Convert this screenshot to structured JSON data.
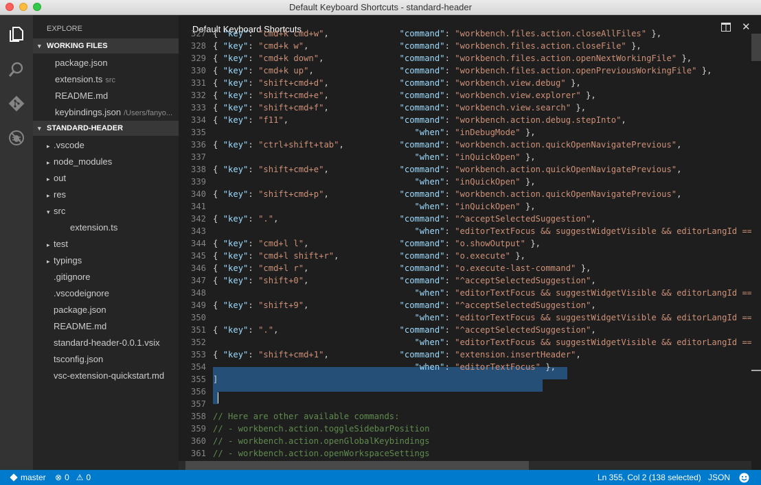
{
  "window": {
    "title": "Default Keyboard Shortcuts - standard-header"
  },
  "activity": [
    "files-icon",
    "search-icon",
    "git-icon",
    "debug-icon"
  ],
  "sidebar": {
    "title": "EXPLORE",
    "working_files": {
      "header": "WORKING FILES",
      "items": [
        {
          "name": "package.json",
          "desc": ""
        },
        {
          "name": "extension.ts",
          "desc": "src"
        },
        {
          "name": "README.md",
          "desc": ""
        },
        {
          "name": "keybindings.json",
          "desc": "/Users/fanyo..."
        }
      ]
    },
    "project": {
      "header": "STANDARD-HEADER",
      "items": [
        {
          "name": ".vscode",
          "twisty": "▸",
          "indent": 1
        },
        {
          "name": "node_modules",
          "twisty": "▸",
          "indent": 1
        },
        {
          "name": "out",
          "twisty": "▸",
          "indent": 1
        },
        {
          "name": "res",
          "twisty": "▸",
          "indent": 1
        },
        {
          "name": "src",
          "twisty": "▾",
          "indent": 1
        },
        {
          "name": "extension.ts",
          "twisty": "",
          "indent": 2
        },
        {
          "name": "test",
          "twisty": "▸",
          "indent": 1
        },
        {
          "name": "typings",
          "twisty": "▸",
          "indent": 1
        },
        {
          "name": ".gitignore",
          "twisty": "",
          "indent": 1
        },
        {
          "name": ".vscodeignore",
          "twisty": "",
          "indent": 1
        },
        {
          "name": "package.json",
          "twisty": "",
          "indent": 1
        },
        {
          "name": "README.md",
          "twisty": "",
          "indent": 1
        },
        {
          "name": "standard-header-0.0.1.vsix",
          "twisty": "",
          "indent": 1
        },
        {
          "name": "tsconfig.json",
          "twisty": "",
          "indent": 1
        },
        {
          "name": "vsc-extension-quickstart.md",
          "twisty": "",
          "indent": 1
        }
      ]
    }
  },
  "editor": {
    "title": "Default Keyboard Shortcuts",
    "lines": [
      {
        "n": "327",
        "key": "cmd+k cmd+w",
        "cmd": "workbench.files.action.closeAllFiles",
        "end": " },",
        "when": null
      },
      {
        "n": "328",
        "key": "cmd+k w",
        "cmd": "workbench.files.action.closeFile",
        "end": " },",
        "when": null
      },
      {
        "n": "329",
        "key": "cmd+k down",
        "cmd": "workbench.files.action.openNextWorkingFile",
        "end": " },",
        "when": null
      },
      {
        "n": "330",
        "key": "cmd+k up",
        "cmd": "workbench.files.action.openPreviousWorkingFile",
        "end": " },",
        "when": null
      },
      {
        "n": "331",
        "key": "shift+cmd+d",
        "cmd": "workbench.view.debug",
        "end": " },",
        "when": null
      },
      {
        "n": "332",
        "key": "shift+cmd+e",
        "cmd": "workbench.view.explorer",
        "end": " },",
        "when": null
      },
      {
        "n": "333",
        "key": "shift+cmd+f",
        "cmd": "workbench.view.search",
        "end": " },",
        "when": null
      },
      {
        "n": "334",
        "key": "f11",
        "cmd": "workbench.action.debug.stepInto",
        "end": ",",
        "when": null
      },
      {
        "n": "335",
        "key": null,
        "cmd": null,
        "end": " },",
        "when": "inDebugMode"
      },
      {
        "n": "336",
        "key": "ctrl+shift+tab",
        "cmd": "workbench.action.quickOpenNavigatePrevious",
        "end": ",",
        "when": null
      },
      {
        "n": "337",
        "key": null,
        "cmd": null,
        "end": " },",
        "when": "inQuickOpen"
      },
      {
        "n": "338",
        "key": "shift+cmd+e",
        "cmd": "workbench.action.quickOpenNavigatePrevious",
        "end": ",",
        "when": null
      },
      {
        "n": "339",
        "key": null,
        "cmd": null,
        "end": " },",
        "when": "inQuickOpen"
      },
      {
        "n": "340",
        "key": "shift+cmd+p",
        "cmd": "workbench.action.quickOpenNavigatePrevious",
        "end": ",",
        "when": null
      },
      {
        "n": "341",
        "key": null,
        "cmd": null,
        "end": " },",
        "when": "inQuickOpen"
      },
      {
        "n": "342",
        "key": ".",
        "cmd": "^acceptSelectedSuggestion",
        "end": ",",
        "when": null
      },
      {
        "n": "343",
        "key": null,
        "cmd": null,
        "end": "",
        "when": "editorTextFocus && suggestWidgetVisible && editorLangId == 'types"
      },
      {
        "n": "344",
        "key": "cmd+l l",
        "cmd": "o.showOutput",
        "end": " },",
        "when": null
      },
      {
        "n": "345",
        "key": "cmd+l shift+r",
        "cmd": "o.execute",
        "end": " },",
        "when": null
      },
      {
        "n": "346",
        "key": "cmd+l r",
        "cmd": "o.execute-last-command",
        "end": " },",
        "when": null
      },
      {
        "n": "347",
        "key": "shift+0",
        "cmd": "^acceptSelectedSuggestion",
        "end": ",",
        "when": null
      },
      {
        "n": "348",
        "key": null,
        "cmd": null,
        "end": "",
        "when": "editorTextFocus && suggestWidgetVisible && editorLangId == 'cshar"
      },
      {
        "n": "349",
        "key": "shift+9",
        "cmd": "^acceptSelectedSuggestion",
        "end": ",",
        "when": null
      },
      {
        "n": "350",
        "key": null,
        "cmd": null,
        "end": "",
        "when": "editorTextFocus && suggestWidgetVisible && editorLangId == 'cshar"
      },
      {
        "n": "351",
        "key": ".",
        "cmd": "^acceptSelectedSuggestion",
        "end": ",",
        "when": null
      },
      {
        "n": "352",
        "key": null,
        "cmd": null,
        "end": "",
        "when": "editorTextFocus && suggestWidgetVisible && editorLangId == 'cshar"
      },
      {
        "n": "353",
        "key": "shift+cmd+1",
        "cmd": "extension.insertHeader",
        "end": ",",
        "when": null
      },
      {
        "n": "354",
        "key": null,
        "cmd": null,
        "end": " },",
        "when": "editorTextFocus"
      },
      {
        "n": "355",
        "raw": "]"
      },
      {
        "n": "356",
        "raw": ""
      },
      {
        "n": "357",
        "raw": ""
      },
      {
        "n": "358",
        "comment": "// Here are other available commands:"
      },
      {
        "n": "359",
        "comment": "// - workbench.action.toggleSidebarPosition"
      },
      {
        "n": "360",
        "comment": "// - workbench.action.openGlobalKeybindings"
      },
      {
        "n": "361",
        "comment": "// - workbench.action.openWorkspaceSettings"
      }
    ]
  },
  "status": {
    "branch": "master",
    "errors": "0",
    "warnings": "0",
    "position": "Ln 355, Col 2 (138 selected)",
    "language": "JSON",
    "feedback_icon": "smiley-icon"
  },
  "colors": {
    "key": "#9cdcfe",
    "string": "#ce9178",
    "comment": "#608b4e",
    "selection": "#264f78",
    "statusbar": "#007acc"
  }
}
